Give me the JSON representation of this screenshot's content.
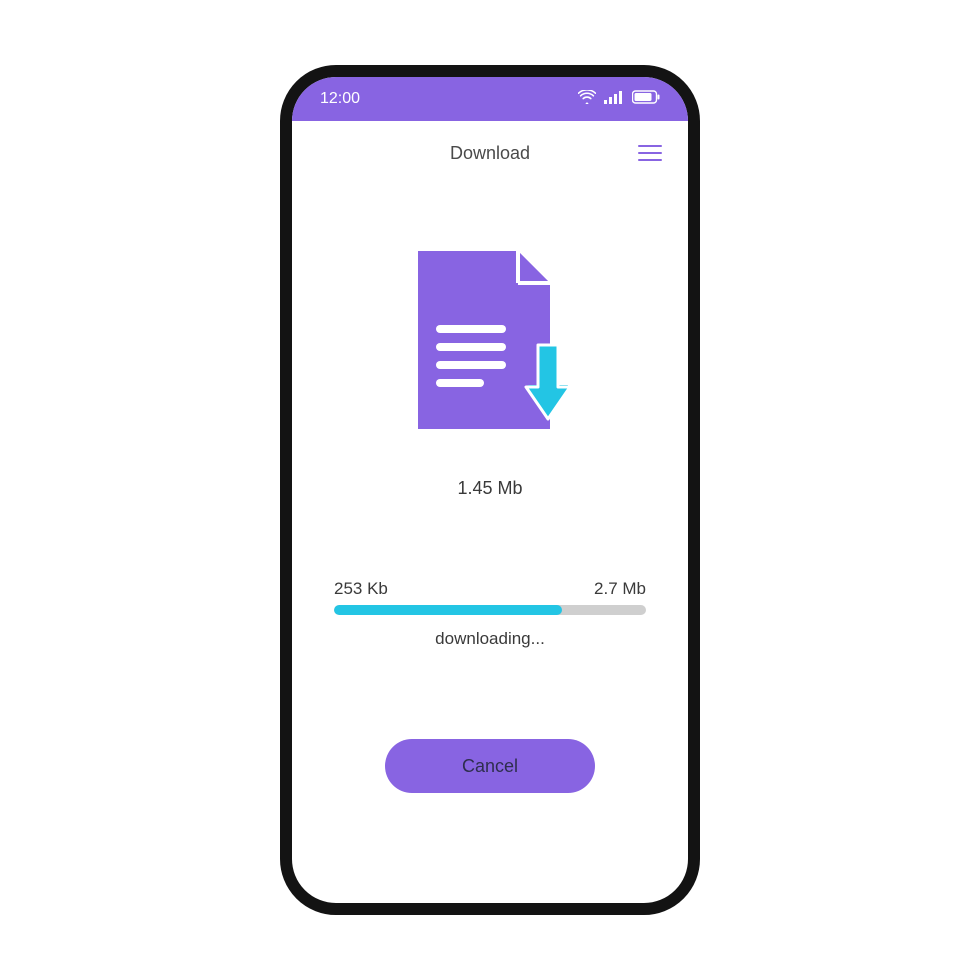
{
  "status_bar": {
    "time": "12:00"
  },
  "header": {
    "title": "Download"
  },
  "file": {
    "size_label": "1.45 Mb"
  },
  "progress": {
    "downloaded_label": "253 Kb",
    "total_label": "2.7 Mb",
    "percent": 73,
    "status_text": "downloading..."
  },
  "actions": {
    "cancel_label": "Cancel"
  },
  "colors": {
    "accent_purple": "#8864e2",
    "accent_cyan": "#23c5e4",
    "track_gray": "#cfcfcf",
    "text_dark": "#3a3a3a"
  }
}
